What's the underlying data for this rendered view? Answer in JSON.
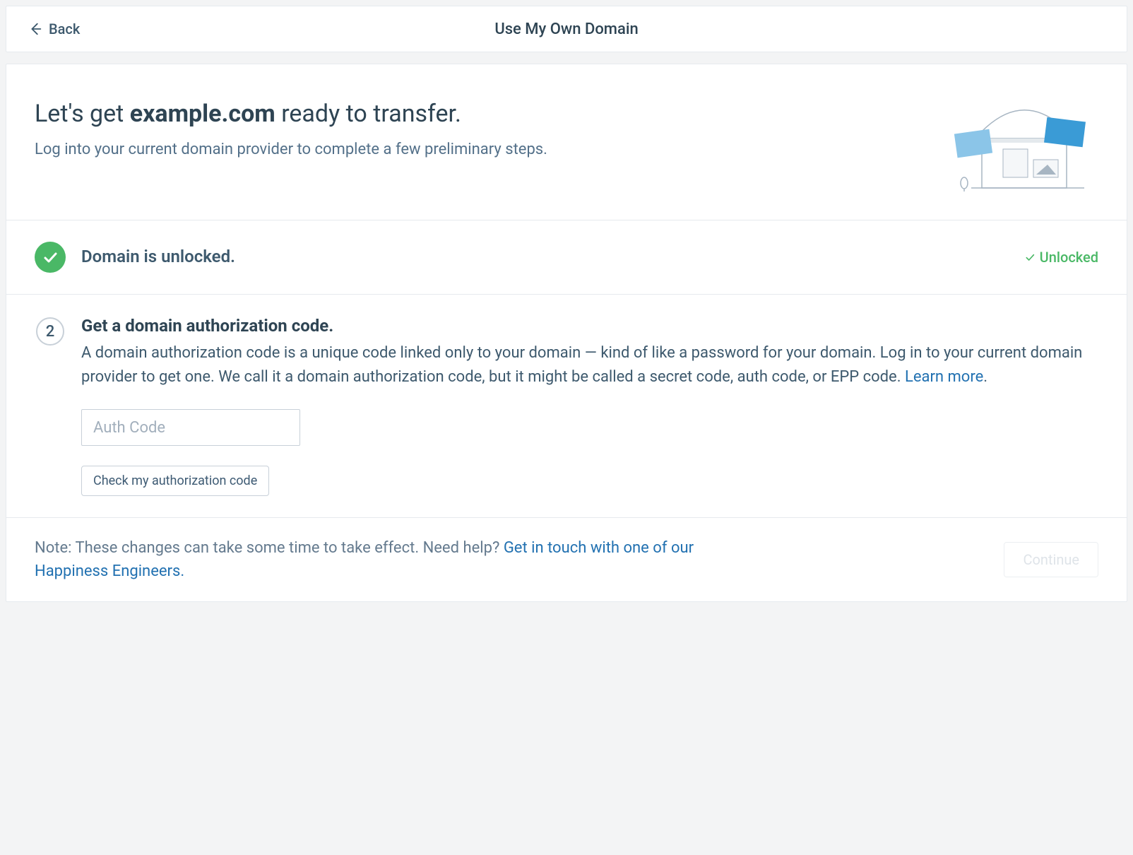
{
  "header": {
    "back_label": "Back",
    "title": "Use My Own Domain"
  },
  "intro": {
    "heading_pre": "Let's get ",
    "domain": "example.com",
    "heading_post": " ready to transfer.",
    "subtext": "Log into your current domain provider to complete a few preliminary steps."
  },
  "step1": {
    "title": "Domain is unlocked.",
    "status": "Unlocked"
  },
  "step2": {
    "number": "2",
    "title": "Get a domain authorization code.",
    "desc": "A domain authorization code is a unique code linked only to your domain — kind of like a password for your domain. Log in to your current domain provider to get one. We call it a domain authorization code, but it might be called a secret code, auth code, or EPP code. ",
    "learn_more": "Learn more",
    "desc_after": ".",
    "placeholder": "Auth Code",
    "check_btn": "Check my authorization code"
  },
  "footer": {
    "note_pre": "Note: These changes can take some time to take effect. Need help? ",
    "link": "Get in touch with one of our Happiness Engineers.",
    "continue": "Continue"
  }
}
